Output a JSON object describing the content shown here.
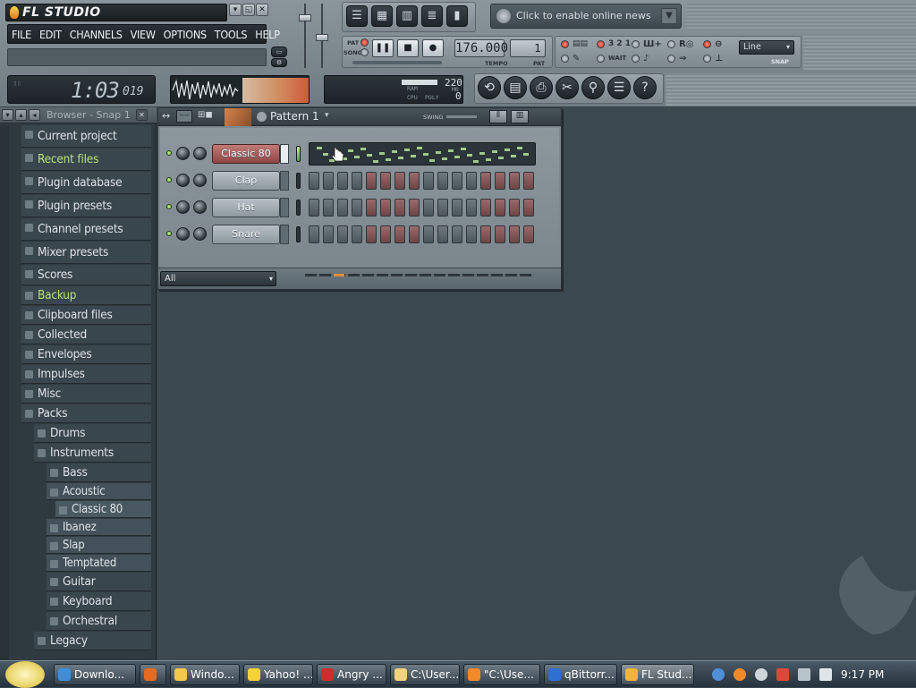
{
  "app": {
    "title": "FL STUDIO",
    "window_buttons": [
      "▾",
      "◱",
      "✕"
    ]
  },
  "menu": [
    "FILE",
    "EDIT",
    "CHANNELS",
    "VIEW",
    "OPTIONS",
    "TOOLS",
    "HELP"
  ],
  "time_display": {
    "main": "1:03",
    "sub": "019"
  },
  "cpu": {
    "ram_label": "RAM",
    "cpu_label": "CPU",
    "poly_label": "POLY",
    "value1": "220",
    "value2": "0",
    "mb": "MB"
  },
  "transport": {
    "pat_label": "PAT",
    "song_label": "SONG",
    "tempo": "176.000",
    "tempo_label": "TEMPO",
    "pattern_num": "1",
    "pat_small_label": "PAT"
  },
  "news": {
    "text": "Click to enable online news"
  },
  "snap": {
    "value": "Line",
    "label": "SNAP"
  },
  "browser": {
    "title": "Browser - Snap 1",
    "items": [
      {
        "label": "Current project",
        "level": 0,
        "highlight": false
      },
      {
        "label": "Recent files",
        "level": 0,
        "highlight": true
      },
      {
        "label": "Plugin database",
        "level": 0,
        "highlight": false
      },
      {
        "label": "Plugin presets",
        "level": 0,
        "highlight": false
      },
      {
        "label": "Channel presets",
        "level": 0,
        "highlight": false
      },
      {
        "label": "Mixer presets",
        "level": 0,
        "highlight": false
      },
      {
        "label": "Scores",
        "level": 0,
        "highlight": false
      },
      {
        "label": "Backup",
        "level": 0,
        "highlight": true
      },
      {
        "label": "Clipboard files",
        "level": 0,
        "highlight": false
      },
      {
        "label": "Collected",
        "level": 0,
        "highlight": false
      },
      {
        "label": "Envelopes",
        "level": 0,
        "highlight": false
      },
      {
        "label": "Impulses",
        "level": 0,
        "highlight": false
      },
      {
        "label": "Misc",
        "level": 0,
        "highlight": false
      },
      {
        "label": "Packs",
        "level": 0,
        "highlight": false
      },
      {
        "label": "Drums",
        "level": 1,
        "highlight": false
      },
      {
        "label": "Instruments",
        "level": 1,
        "highlight": false
      },
      {
        "label": "Bass",
        "level": 2,
        "highlight": false
      },
      {
        "label": "Acoustic",
        "level": 3,
        "highlight": false
      },
      {
        "label": "Classic 80",
        "level": 4,
        "highlight": false
      },
      {
        "label": "Ibanez",
        "level": 3,
        "highlight": false
      },
      {
        "label": "Slap",
        "level": 3,
        "highlight": false
      },
      {
        "label": "Temptated",
        "level": 3,
        "highlight": false
      },
      {
        "label": "Guitar",
        "level": 2,
        "highlight": false
      },
      {
        "label": "Keyboard",
        "level": 2,
        "highlight": false
      },
      {
        "label": "Orchestral",
        "level": 2,
        "highlight": false
      },
      {
        "label": "Legacy",
        "level": 1,
        "highlight": false
      }
    ]
  },
  "rack": {
    "pattern": "Pattern 1",
    "swing_label": "SWING",
    "filter": "All",
    "channels": [
      {
        "name": "Classic 80",
        "selected": true,
        "piano_roll": true,
        "steps": []
      },
      {
        "name": "Clap",
        "selected": false,
        "piano_roll": false,
        "steps": [
          0,
          0,
          0,
          0,
          1,
          1,
          1,
          1,
          0,
          0,
          0,
          0,
          1,
          1,
          1,
          1
        ]
      },
      {
        "name": "Hat",
        "selected": false,
        "piano_roll": false,
        "steps": [
          0,
          0,
          0,
          0,
          1,
          1,
          1,
          1,
          0,
          0,
          0,
          0,
          1,
          1,
          1,
          1
        ]
      },
      {
        "name": "Snare",
        "selected": false,
        "piano_roll": false,
        "steps": [
          0,
          0,
          0,
          0,
          1,
          1,
          1,
          1,
          0,
          0,
          0,
          0,
          1,
          1,
          1,
          1
        ]
      }
    ]
  },
  "taskbar": {
    "tasks": [
      {
        "label": "Downlo...",
        "color": "#3f8fd8"
      },
      {
        "label": "",
        "color": "#e56a1f"
      },
      {
        "label": "Windo...",
        "color": "#f3c84a"
      },
      {
        "label": "Yahoo! ...",
        "color": "#f3d23a"
      },
      {
        "label": "Angry ...",
        "color": "#c9302c"
      },
      {
        "label": "C:\\User...",
        "color": "#f1d37a"
      },
      {
        "label": "\"C:\\Use...",
        "color": "#f08a2b"
      },
      {
        "label": "qBittorr...",
        "color": "#2f6fd1"
      },
      {
        "label": "FL Stud...",
        "color": "#f2b33a"
      }
    ],
    "clock": "9:17 PM"
  }
}
